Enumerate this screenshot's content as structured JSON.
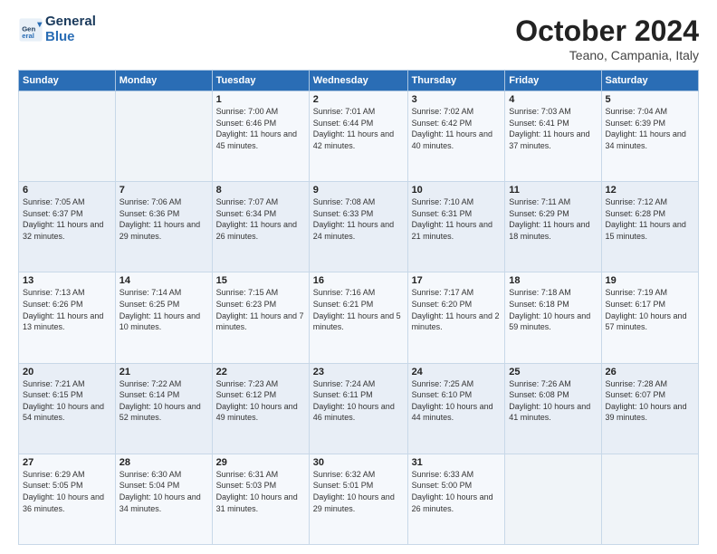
{
  "header": {
    "logo_line1": "General",
    "logo_line2": "Blue",
    "month": "October 2024",
    "location": "Teano, Campania, Italy"
  },
  "days_of_week": [
    "Sunday",
    "Monday",
    "Tuesday",
    "Wednesday",
    "Thursday",
    "Friday",
    "Saturday"
  ],
  "weeks": [
    [
      {
        "num": "",
        "info": ""
      },
      {
        "num": "",
        "info": ""
      },
      {
        "num": "1",
        "info": "Sunrise: 7:00 AM\nSunset: 6:46 PM\nDaylight: 11 hours and 45 minutes."
      },
      {
        "num": "2",
        "info": "Sunrise: 7:01 AM\nSunset: 6:44 PM\nDaylight: 11 hours and 42 minutes."
      },
      {
        "num": "3",
        "info": "Sunrise: 7:02 AM\nSunset: 6:42 PM\nDaylight: 11 hours and 40 minutes."
      },
      {
        "num": "4",
        "info": "Sunrise: 7:03 AM\nSunset: 6:41 PM\nDaylight: 11 hours and 37 minutes."
      },
      {
        "num": "5",
        "info": "Sunrise: 7:04 AM\nSunset: 6:39 PM\nDaylight: 11 hours and 34 minutes."
      }
    ],
    [
      {
        "num": "6",
        "info": "Sunrise: 7:05 AM\nSunset: 6:37 PM\nDaylight: 11 hours and 32 minutes."
      },
      {
        "num": "7",
        "info": "Sunrise: 7:06 AM\nSunset: 6:36 PM\nDaylight: 11 hours and 29 minutes."
      },
      {
        "num": "8",
        "info": "Sunrise: 7:07 AM\nSunset: 6:34 PM\nDaylight: 11 hours and 26 minutes."
      },
      {
        "num": "9",
        "info": "Sunrise: 7:08 AM\nSunset: 6:33 PM\nDaylight: 11 hours and 24 minutes."
      },
      {
        "num": "10",
        "info": "Sunrise: 7:10 AM\nSunset: 6:31 PM\nDaylight: 11 hours and 21 minutes."
      },
      {
        "num": "11",
        "info": "Sunrise: 7:11 AM\nSunset: 6:29 PM\nDaylight: 11 hours and 18 minutes."
      },
      {
        "num": "12",
        "info": "Sunrise: 7:12 AM\nSunset: 6:28 PM\nDaylight: 11 hours and 15 minutes."
      }
    ],
    [
      {
        "num": "13",
        "info": "Sunrise: 7:13 AM\nSunset: 6:26 PM\nDaylight: 11 hours and 13 minutes."
      },
      {
        "num": "14",
        "info": "Sunrise: 7:14 AM\nSunset: 6:25 PM\nDaylight: 11 hours and 10 minutes."
      },
      {
        "num": "15",
        "info": "Sunrise: 7:15 AM\nSunset: 6:23 PM\nDaylight: 11 hours and 7 minutes."
      },
      {
        "num": "16",
        "info": "Sunrise: 7:16 AM\nSunset: 6:21 PM\nDaylight: 11 hours and 5 minutes."
      },
      {
        "num": "17",
        "info": "Sunrise: 7:17 AM\nSunset: 6:20 PM\nDaylight: 11 hours and 2 minutes."
      },
      {
        "num": "18",
        "info": "Sunrise: 7:18 AM\nSunset: 6:18 PM\nDaylight: 10 hours and 59 minutes."
      },
      {
        "num": "19",
        "info": "Sunrise: 7:19 AM\nSunset: 6:17 PM\nDaylight: 10 hours and 57 minutes."
      }
    ],
    [
      {
        "num": "20",
        "info": "Sunrise: 7:21 AM\nSunset: 6:15 PM\nDaylight: 10 hours and 54 minutes."
      },
      {
        "num": "21",
        "info": "Sunrise: 7:22 AM\nSunset: 6:14 PM\nDaylight: 10 hours and 52 minutes."
      },
      {
        "num": "22",
        "info": "Sunrise: 7:23 AM\nSunset: 6:12 PM\nDaylight: 10 hours and 49 minutes."
      },
      {
        "num": "23",
        "info": "Sunrise: 7:24 AM\nSunset: 6:11 PM\nDaylight: 10 hours and 46 minutes."
      },
      {
        "num": "24",
        "info": "Sunrise: 7:25 AM\nSunset: 6:10 PM\nDaylight: 10 hours and 44 minutes."
      },
      {
        "num": "25",
        "info": "Sunrise: 7:26 AM\nSunset: 6:08 PM\nDaylight: 10 hours and 41 minutes."
      },
      {
        "num": "26",
        "info": "Sunrise: 7:28 AM\nSunset: 6:07 PM\nDaylight: 10 hours and 39 minutes."
      }
    ],
    [
      {
        "num": "27",
        "info": "Sunrise: 6:29 AM\nSunset: 5:05 PM\nDaylight: 10 hours and 36 minutes."
      },
      {
        "num": "28",
        "info": "Sunrise: 6:30 AM\nSunset: 5:04 PM\nDaylight: 10 hours and 34 minutes."
      },
      {
        "num": "29",
        "info": "Sunrise: 6:31 AM\nSunset: 5:03 PM\nDaylight: 10 hours and 31 minutes."
      },
      {
        "num": "30",
        "info": "Sunrise: 6:32 AM\nSunset: 5:01 PM\nDaylight: 10 hours and 29 minutes."
      },
      {
        "num": "31",
        "info": "Sunrise: 6:33 AM\nSunset: 5:00 PM\nDaylight: 10 hours and 26 minutes."
      },
      {
        "num": "",
        "info": ""
      },
      {
        "num": "",
        "info": ""
      }
    ]
  ]
}
